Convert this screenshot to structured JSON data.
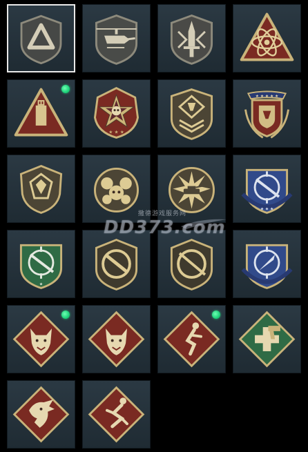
{
  "colors": {
    "tile_bg": "#26343d",
    "selected_border": "#e9e9e9",
    "new_dot": "#1ed27a",
    "gold": "#c9b37a",
    "tan": "#d9c9a0",
    "maroon": "#7a2a22",
    "green": "#2f6b45",
    "blue": "#314a8a"
  },
  "emblems": [
    {
      "name": "triangle-a-shield-emblem",
      "selected": true,
      "new": false
    },
    {
      "name": "helicopter-shield-emblem",
      "selected": false,
      "new": false
    },
    {
      "name": "dagger-shield-emblem",
      "selected": false,
      "new": false
    },
    {
      "name": "atom-triangle-emblem",
      "selected": false,
      "new": false
    },
    {
      "name": "usb-triangle-emblem",
      "selected": false,
      "new": true
    },
    {
      "name": "skull-star-badge-emblem",
      "selected": false,
      "new": false
    },
    {
      "name": "diamond-chevron-shield-emblem",
      "selected": false,
      "new": false
    },
    {
      "name": "laurel-crest-emblem",
      "selected": false,
      "new": false
    },
    {
      "name": "gem-shield-emblem",
      "selected": false,
      "new": false
    },
    {
      "name": "skull-cluster-emblem",
      "selected": false,
      "new": false
    },
    {
      "name": "tank-sunburst-emblem",
      "selected": false,
      "new": false
    },
    {
      "name": "rifle-crosshair-blue-shield-emblem",
      "selected": false,
      "new": false
    },
    {
      "name": "rifle-crosshair-green-shield-emblem",
      "selected": false,
      "new": false
    },
    {
      "name": "smg-circle-shield-emblem",
      "selected": false,
      "new": false
    },
    {
      "name": "sniper-circle-shield-emblem",
      "selected": false,
      "new": false
    },
    {
      "name": "knife-crosshair-blue-shield-emblem",
      "selected": false,
      "new": false
    },
    {
      "name": "wolf-diamond-emblem",
      "selected": false,
      "new": true
    },
    {
      "name": "wolf-diamond-emblem-2",
      "selected": false,
      "new": false
    },
    {
      "name": "runner-diamond-emblem",
      "selected": false,
      "new": true
    },
    {
      "name": "medic-pistol-diamond-emblem",
      "selected": false,
      "new": false
    },
    {
      "name": "dragon-diamond-emblem",
      "selected": false,
      "new": false
    },
    {
      "name": "sprinter-diamond-emblem",
      "selected": false,
      "new": false
    }
  ],
  "watermark": {
    "small_text": "撒德游戏服务网",
    "big_text": "DD373.com"
  }
}
